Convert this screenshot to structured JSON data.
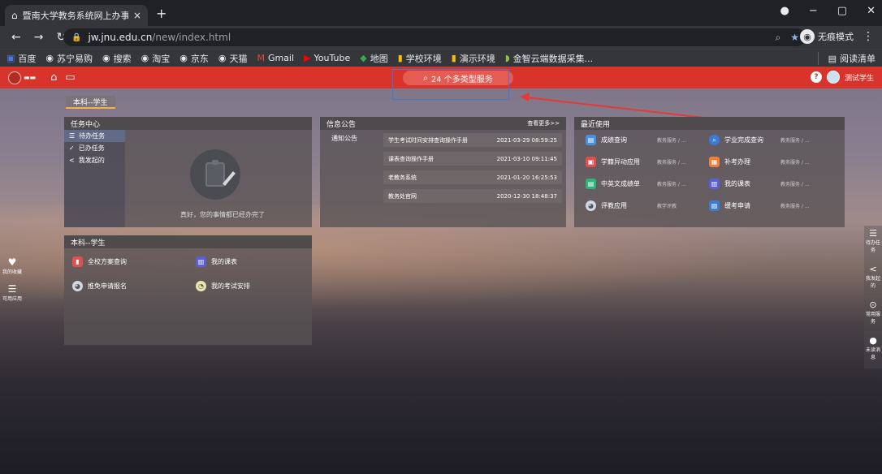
{
  "browser": {
    "tab_title": "暨南大学教务系统网上办事服务",
    "tab_close": "×",
    "new_tab": "+",
    "url_host": "jw.jnu.edu.cn",
    "url_path": "/new/index.html",
    "incognito_label": "无痕模式",
    "bookmarks": [
      "百度",
      "苏宁易购",
      "搜索",
      "淘宝",
      "京东",
      "天猫",
      "Gmail",
      "YouTube",
      "地图",
      "学校环境",
      "演示环境",
      "金智云端数据采集..."
    ],
    "reading_list": "阅读清单"
  },
  "header": {
    "service_button": "24 个多类型服务",
    "user_name": "测试学生"
  },
  "role_tab": "本科--学生",
  "task_center": {
    "title": "任务中心",
    "items": [
      "待办任务",
      "已办任务",
      "我发起的"
    ],
    "empty_message": "真好，您的事情都已经办完了"
  },
  "info": {
    "title": "信息公告",
    "more": "查看更多>>",
    "category": "通知公告",
    "rows": [
      {
        "title": "学生考试时间安排查询操作手册",
        "date": "2021-03-29 08:59:25"
      },
      {
        "title": "课表查询操作手册",
        "date": "2021-03-10 09:11:45"
      },
      {
        "title": "老教务系统",
        "date": "2021-01-20 16:25:53"
      },
      {
        "title": "教务处官网",
        "date": "2020-12-30 18:48:37"
      }
    ]
  },
  "recent": {
    "title": "最近使用",
    "items": [
      {
        "name": "成绩查询",
        "sub": "教务服务 / ..."
      },
      {
        "name": "学业完成查询",
        "sub": "教务服务 / ..."
      },
      {
        "name": "学籍异动应用",
        "sub": "教务服务 / ..."
      },
      {
        "name": "补考办理",
        "sub": "教务服务 / ..."
      },
      {
        "name": "中英文成绩单",
        "sub": "教务服务 / ..."
      },
      {
        "name": "我的课表",
        "sub": "教务服务 / ..."
      },
      {
        "name": "评教应用",
        "sub": "教学评教"
      },
      {
        "name": "缓考申请",
        "sub": "教务服务 / ..."
      }
    ]
  },
  "schedule": {
    "title": "本科--学生",
    "items": [
      "全校方案查询",
      "我的课表",
      "推免申请报名",
      "我的考试安排"
    ]
  },
  "left_dock": [
    "我的收藏",
    "可用应用"
  ],
  "right_dock": [
    "待办任务",
    "我发起的",
    "常用服务",
    "未读消息"
  ],
  "colors": {
    "brand_red": "#d9342b",
    "highlight_blue": "#3b7ad6"
  }
}
